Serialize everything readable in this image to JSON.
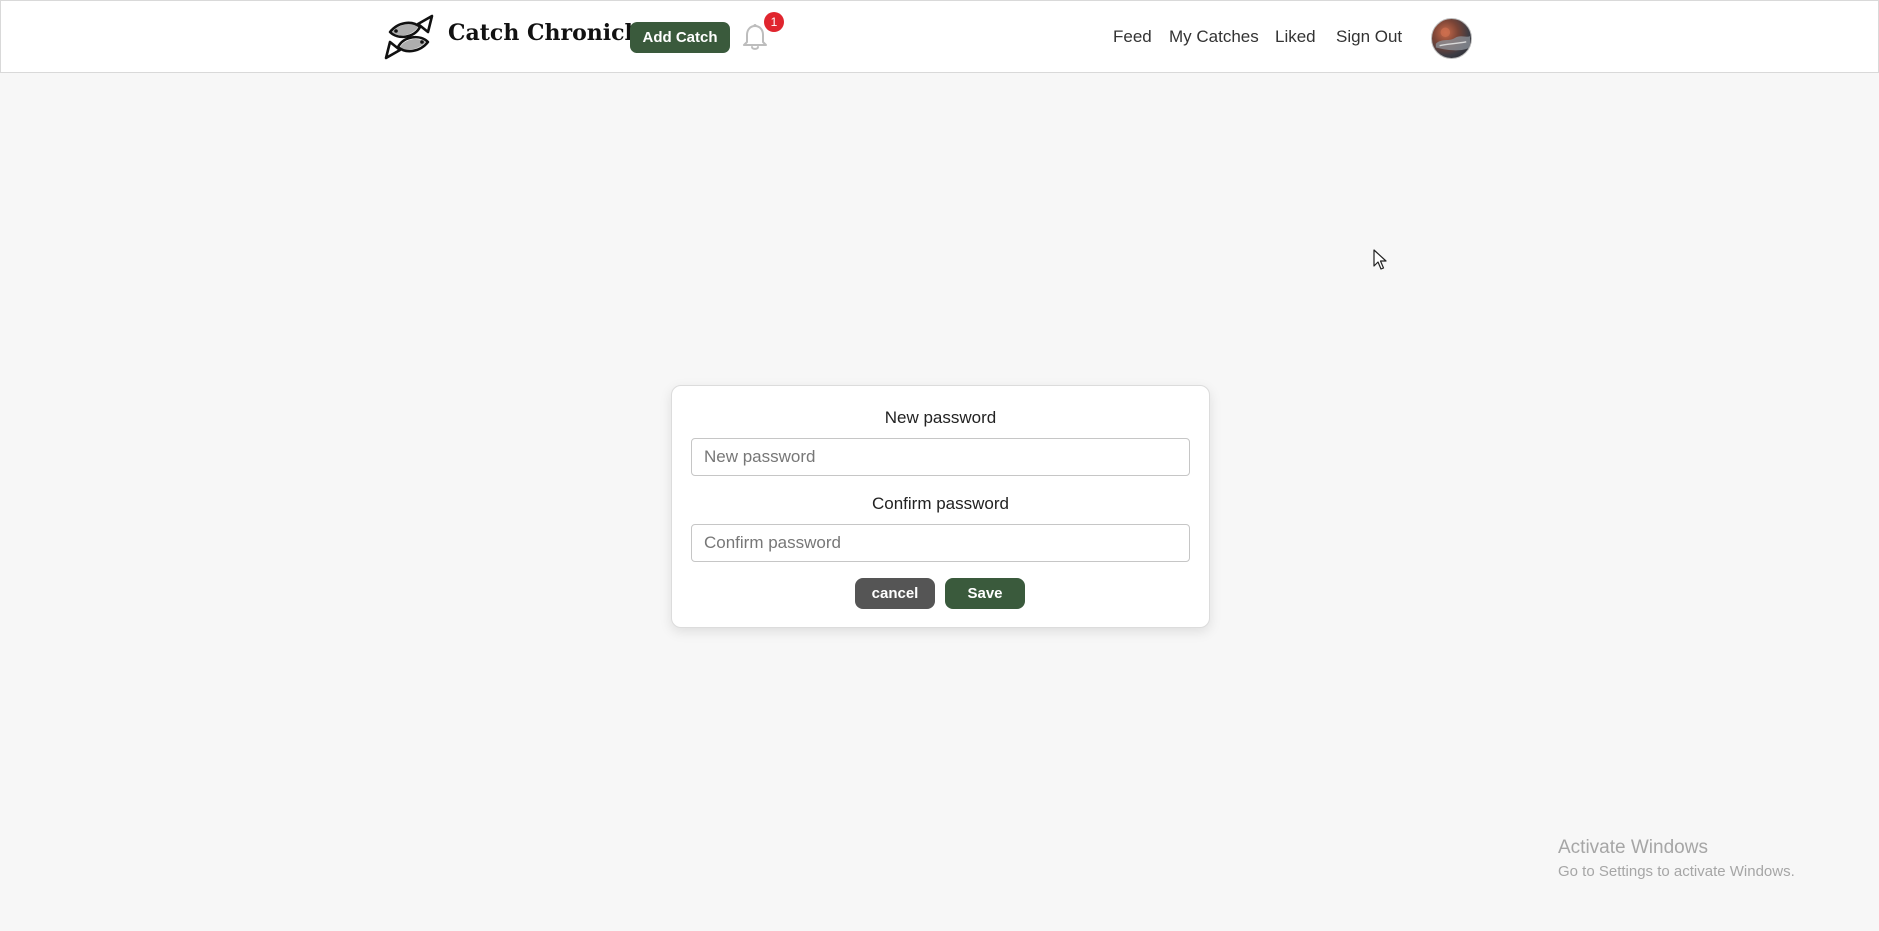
{
  "header": {
    "brand": "Catch Chronicle",
    "logo_icon": "fish-logo-icon",
    "add_catch_label": "Add Catch",
    "notification_count": "1",
    "nav": {
      "feed": "Feed",
      "my_catches": "My Catches",
      "liked": "Liked",
      "sign_out": "Sign Out"
    }
  },
  "form": {
    "new_password_label": "New password",
    "new_password_placeholder": "New password",
    "new_password_value": "",
    "confirm_password_label": "Confirm password",
    "confirm_password_placeholder": "Confirm password",
    "confirm_password_value": "",
    "cancel_label": "cancel",
    "save_label": "Save"
  },
  "watermark": {
    "title": "Activate Windows",
    "subtitle": "Go to Settings to activate Windows."
  },
  "colors": {
    "primary": "#3a5a3c",
    "cancel": "#555555",
    "badge": "#e0252e",
    "background": "#f7f7f7"
  }
}
